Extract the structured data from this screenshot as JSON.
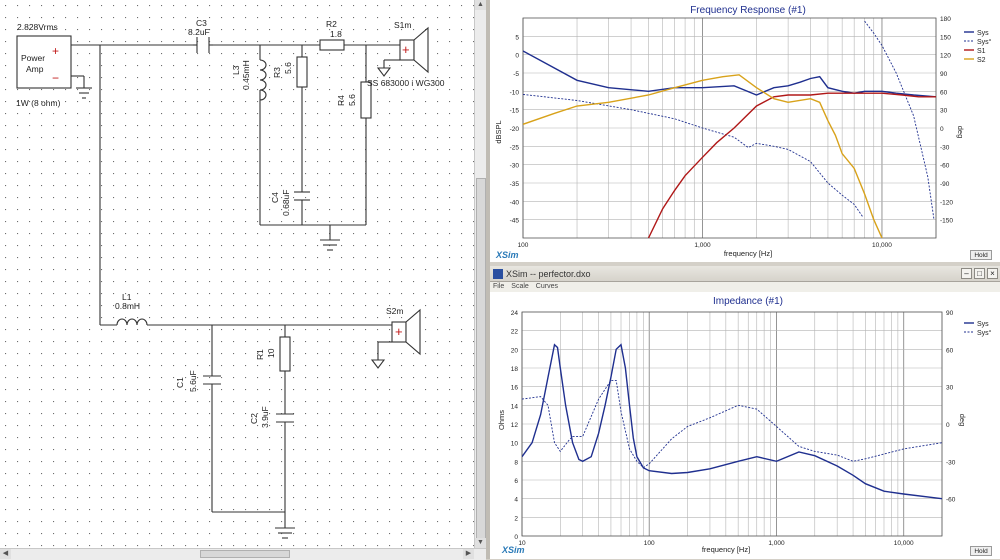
{
  "schematic": {
    "source_voltage": "2.828Vrms",
    "source_label": "Power Amp",
    "source_note": "1W (8 ohm)",
    "C3": {
      "name": "C3",
      "value": "8.2uF"
    },
    "R2": {
      "name": "R2",
      "value": "1.8"
    },
    "S1": {
      "name": "S1m",
      "model": "SS 683000 i WG300"
    },
    "L3": {
      "name": "L3",
      "value": "0.45mH"
    },
    "R3": {
      "name": "R3",
      "value": "5.6"
    },
    "R4": {
      "name": "R4",
      "value": "5.6"
    },
    "C4": {
      "name": "C4",
      "value": "0.68uF"
    },
    "L1": {
      "name": "L1",
      "value": "0.8mH"
    },
    "S2": {
      "name": "S2m"
    },
    "C1": {
      "name": "C1",
      "value": "5.6uF"
    },
    "R1": {
      "name": "R1",
      "value": "10"
    },
    "C2": {
      "name": "C2",
      "value": "3.9uF"
    },
    "plus": "+",
    "minus": "−"
  },
  "freq_window": {
    "title": "Frequency Response (#1)",
    "logo": "XSim",
    "hold": "Hold",
    "xlabel": "frequency [Hz]",
    "ylabel_left": "dBSPL",
    "ylabel_right": "deg",
    "x_ticks": [
      "100",
      "1,000",
      "10,000"
    ],
    "y_left_ticks": [
      "5",
      "0",
      "-5",
      "-10",
      "-15",
      "-20",
      "-25",
      "-30",
      "-35",
      "-40",
      "-45"
    ],
    "y_right_ticks": [
      "180",
      "150",
      "120",
      "90",
      "60",
      "30",
      "0",
      "-30",
      "-60",
      "-90",
      "-120",
      "-150"
    ],
    "legend": [
      {
        "label": "Sys",
        "color": "#1f2f8f",
        "dash": false
      },
      {
        "label": "Sys°",
        "color": "#1f2f8f",
        "dash": true
      },
      {
        "label": "S1",
        "color": "#b01818",
        "dash": false
      },
      {
        "label": "S2",
        "color": "#d8a21a",
        "dash": false
      }
    ]
  },
  "imp_window": {
    "titlebar": "XSim -- perfector.dxo",
    "menu": [
      "File",
      "Scale",
      "Curves"
    ],
    "title": "Impedance (#1)",
    "logo": "XSim",
    "hold": "Hold",
    "xlabel": "frequency [Hz]",
    "ylabel_left": "Ohms",
    "ylabel_right": "deg",
    "x_ticks": [
      "10",
      "100",
      "1,000",
      "10,000"
    ],
    "y_left_ticks": [
      "24",
      "22",
      "20",
      "18",
      "16",
      "14",
      "12",
      "10",
      "8",
      "6",
      "4",
      "2",
      "0"
    ],
    "y_right_ticks": [
      "90",
      "60",
      "30",
      "0",
      "-30",
      "-60"
    ],
    "legend": [
      {
        "label": "Sys",
        "color": "#1f2f8f",
        "dash": false
      },
      {
        "label": "Sys°",
        "color": "#1f2f8f",
        "dash": true
      }
    ]
  },
  "chart_data": [
    {
      "type": "line",
      "title": "Frequency Response (#1)",
      "xlabel": "frequency [Hz]",
      "ylabel": "dBSPL",
      "xscale": "log",
      "xlim": [
        100,
        20000
      ],
      "ylim": [
        -50,
        10
      ],
      "y2label": "deg",
      "y2lim": [
        -180,
        180
      ],
      "grid": true,
      "legend": "top-right",
      "series": [
        {
          "name": "Sys",
          "axis": "left",
          "color": "#1f2f8f",
          "x": [
            100,
            200,
            300,
            500,
            700,
            1000,
            1500,
            2000,
            2500,
            3000,
            3500,
            4000,
            4500,
            5000,
            6000,
            7000,
            8000,
            10000,
            12000,
            15000,
            20000
          ],
          "y": [
            1,
            -7,
            -9,
            -10,
            -9,
            -9,
            -8.5,
            -11,
            -9,
            -8.5,
            -7.5,
            -6.5,
            -6,
            -9,
            -10,
            -10.5,
            -10,
            -10,
            -10.5,
            -11,
            -11.5
          ]
        },
        {
          "name": "Sys°",
          "axis": "right",
          "color": "#1f2f8f",
          "dash": true,
          "x": [
            100,
            200,
            400,
            700,
            1000,
            1500,
            1800,
            2000,
            2500,
            3000,
            4000,
            5000,
            6000,
            7000,
            7800,
            8000,
            9000,
            10000,
            12000,
            15000,
            18000,
            19500
          ],
          "y": [
            55,
            45,
            30,
            15,
            0,
            -15,
            -32,
            -25,
            -30,
            -35,
            -55,
            -90,
            -110,
            -125,
            -145,
            175,
            155,
            135,
            90,
            20,
            -80,
            -150
          ]
        },
        {
          "name": "S1",
          "axis": "left",
          "color": "#b01818",
          "x": [
            500,
            600,
            700,
            800,
            1000,
            1200,
            1500,
            2000,
            2500,
            3000,
            4000,
            5000,
            6000,
            8000,
            10000,
            13000,
            16000,
            20000
          ],
          "y": [
            -50,
            -42,
            -37,
            -33,
            -28,
            -24,
            -20,
            -14,
            -11.5,
            -11,
            -11,
            -10.5,
            -10.5,
            -10.5,
            -10.5,
            -11,
            -11.5,
            -11.5
          ]
        },
        {
          "name": "S2",
          "axis": "left",
          "color": "#d8a21a",
          "x": [
            100,
            150,
            200,
            300,
            500,
            700,
            1000,
            1300,
            1600,
            2000,
            2500,
            3000,
            4000,
            4500,
            5000,
            5500,
            6000,
            7000,
            8000,
            9000,
            10000
          ],
          "y": [
            -19,
            -16,
            -14,
            -13,
            -11,
            -9,
            -7,
            -6,
            -5.5,
            -9,
            -12,
            -13,
            -12,
            -13,
            -18,
            -22,
            -27,
            -31,
            -38,
            -45,
            -50
          ]
        }
      ]
    },
    {
      "type": "line",
      "title": "Impedance (#1)",
      "xlabel": "frequency [Hz]",
      "ylabel": "Ohms",
      "xscale": "log",
      "xlim": [
        10,
        20000
      ],
      "ylim": [
        0,
        24
      ],
      "y2label": "deg",
      "y2lim": [
        -90,
        90
      ],
      "grid": true,
      "legend": "top-right",
      "series": [
        {
          "name": "Sys",
          "axis": "left",
          "color": "#1f2f8f",
          "x": [
            10,
            12,
            14,
            16,
            18,
            19,
            20,
            22,
            25,
            28,
            30,
            35,
            40,
            45,
            50,
            55,
            60,
            65,
            70,
            75,
            80,
            90,
            100,
            150,
            200,
            300,
            500,
            700,
            1000,
            1500,
            2000,
            3000,
            4000,
            5000,
            7000,
            10000,
            20000
          ],
          "y": [
            8.5,
            10,
            13,
            17,
            20.5,
            20.2,
            18,
            14,
            10,
            8.2,
            8,
            8.5,
            11,
            14,
            17,
            20,
            20.5,
            18,
            14,
            10.5,
            8.5,
            7.3,
            7,
            6.7,
            6.8,
            7.2,
            8,
            8.5,
            8,
            9,
            8.6,
            7.5,
            6.5,
            5.6,
            4.8,
            4.5,
            4
          ]
        },
        {
          "name": "Sys°",
          "axis": "right",
          "color": "#1f2f8f",
          "dash": true,
          "x": [
            10,
            14,
            16,
            18,
            20,
            23,
            25,
            30,
            40,
            50,
            55,
            60,
            70,
            80,
            90,
            100,
            150,
            200,
            300,
            500,
            700,
            1000,
            1500,
            2000,
            3000,
            4000,
            5000,
            10000,
            20000
          ],
          "y": [
            20,
            22,
            15,
            -15,
            -22,
            -14,
            -10,
            -10,
            20,
            35,
            35,
            10,
            -20,
            -30,
            -35,
            -32,
            -12,
            -2,
            5,
            15,
            12,
            -2,
            -18,
            -22,
            -25,
            -30,
            -28,
            -20,
            -15
          ]
        }
      ]
    }
  ]
}
